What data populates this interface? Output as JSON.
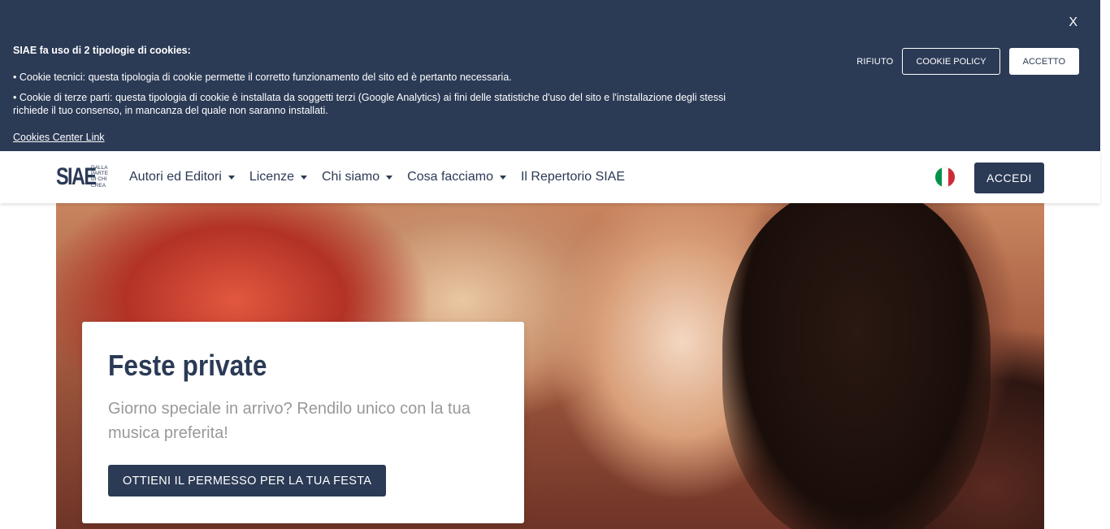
{
  "cookie_banner": {
    "close_label": "X",
    "title": "SIAE fa uso di 2 tipologie di cookies:",
    "line_technical": "• Cookie tecnici: questa tipologia di cookie permette il corretto funzionamento del sito ed è pertanto necessaria.",
    "line_third_party": "• Cookie di terze parti: questa tipologia di cookie è installata da soggetti terzi (Google Analytics) ai fini delle statistiche d'uso del sito e l'installazione degli stessi richiede il tuo consenso, in mancanza del quale non saranno installati.",
    "center_link": "Cookies Center Link",
    "reject_label": "RIFIUTO",
    "policy_label": "COOKIE POLICY",
    "accept_label": "ACCETTO"
  },
  "header": {
    "logo_text": "SIAE",
    "logo_tagline": "DALLA PARTE DI CHI CREA",
    "nav": [
      {
        "label": "Autori ed Editori",
        "dropdown": true
      },
      {
        "label": "Licenze",
        "dropdown": true
      },
      {
        "label": "Chi siamo",
        "dropdown": true
      },
      {
        "label": "Cosa facciamo",
        "dropdown": true
      },
      {
        "label": "Il Repertorio SIAE",
        "dropdown": false
      }
    ],
    "language_flag": "italy-flag-icon",
    "login_label": "ACCEDI"
  },
  "hero": {
    "title": "Feste private",
    "subtitle": "Giorno speciale in arrivo? Rendilo unico con la tua musica preferita!",
    "cta_label": "OTTIENI IL PERMESSO PER LA TUA FESTA"
  },
  "colors": {
    "brand_navy": "#2b3a55",
    "flag_green": "#009246",
    "flag_white": "#ffffff",
    "flag_red": "#ce2b37"
  }
}
